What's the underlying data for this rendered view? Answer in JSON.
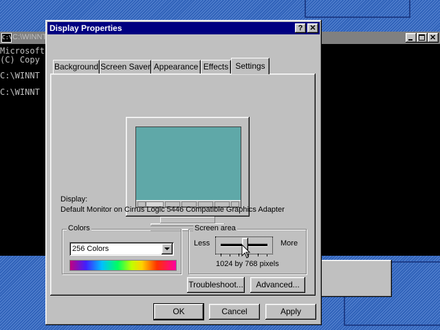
{
  "console": {
    "title": "C:\\WINNT",
    "lines": [
      "Microsoft",
      "(C) Copy",
      "",
      "C:\\WINNT",
      "",
      "C:\\WINNT"
    ]
  },
  "dialog": {
    "title": "Display Properties",
    "help_glyph": "?",
    "close_glyph": "✕",
    "tabs": [
      "Background",
      "Screen Saver",
      "Appearance",
      "Effects",
      "Settings"
    ],
    "active_tab": "Settings",
    "display_label": "Display:",
    "display_value": "Default Monitor on Cirrus Logic 5446 Compatible Graphics Adapter",
    "colors": {
      "label": "Colors",
      "selected": "256 Colors"
    },
    "screen_area": {
      "label": "Screen area",
      "less": "Less",
      "more": "More",
      "value_text": "1024 by 768 pixels",
      "slider_fraction": 0.6
    },
    "troubleshoot_button": "Troubleshoot...",
    "advanced_button": "Advanced...",
    "ok_button": "OK",
    "cancel_button": "Cancel",
    "apply_button": "Apply"
  },
  "colors": {
    "desktop": "#2f62b9",
    "title_active": "#000080",
    "monitor_screen": "#5fa8a8",
    "face": "#c0c0c0"
  }
}
